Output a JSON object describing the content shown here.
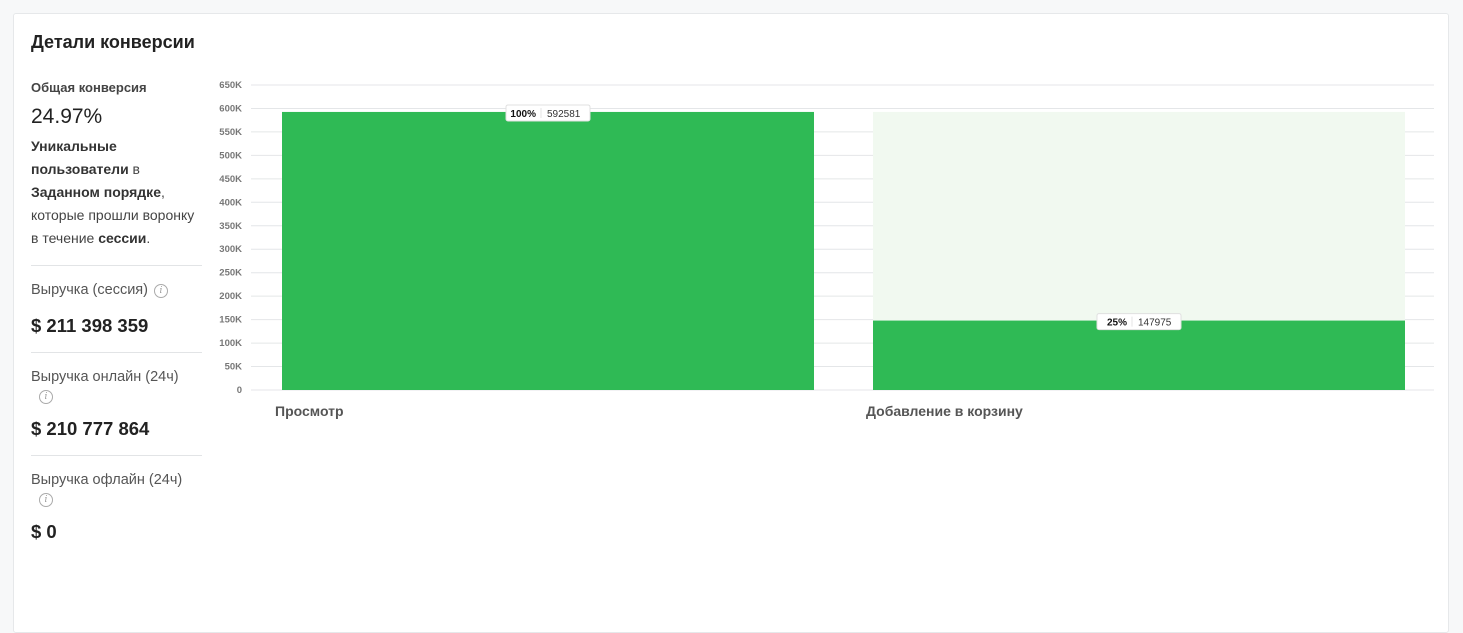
{
  "panel": {
    "title": "Детали конверсии"
  },
  "summary": {
    "overall_label": "Общая конверсия",
    "overall_value": "24.97%",
    "description": {
      "p1_bold": "Уникальные пользователи",
      "p2": " в ",
      "p3_bold": "Заданном порядке",
      "p4": ", которые прошли воронку в течение ",
      "p5_bold": "сессии",
      "p6": "."
    }
  },
  "revenue": [
    {
      "label": "Выручка (сессия)",
      "value": "$ 211 398 359",
      "icon": "info-icon"
    },
    {
      "label": "Выручка онлайн (24ч)",
      "value": "$ 210 777 864",
      "icon": "info-icon"
    },
    {
      "label": "Выручка офлайн (24ч)",
      "value": "$ 0",
      "icon": "info-icon"
    }
  ],
  "chart_data": {
    "type": "bar",
    "categories": [
      "Просмотр",
      "Добавление в корзину"
    ],
    "values": [
      592581,
      147975
    ],
    "percent_labels": [
      "100%",
      "25%"
    ],
    "value_labels": [
      "592581",
      "147975"
    ],
    "y_tick_labels": [
      "0",
      "50K",
      "100K",
      "150K",
      "200K",
      "250K",
      "300K",
      "350K",
      "400K",
      "450K",
      "500K",
      "550K",
      "600K",
      "650K"
    ],
    "ylim": [
      0,
      650000
    ],
    "grid": true,
    "drop_off_shaded": true,
    "colors": {
      "bar": "#2fba55",
      "dropoff": "#f1f9f0",
      "grid": "#e4e6e8"
    }
  }
}
